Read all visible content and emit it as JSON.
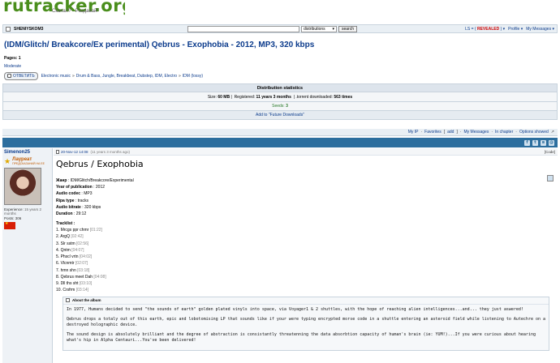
{
  "site": {
    "logo_text": "rutracker.org",
    "tagline": "Скачал? - Раздавай!"
  },
  "topbar": {
    "username": "SHENIYSKOM3",
    "search_value": "",
    "search_scope": "distributions",
    "search_button": "search",
    "user_links": {
      "ls": "LS",
      "revealed": "REVEALED",
      "profile": "Profile",
      "messages": "My Messages"
    }
  },
  "topic": {
    "title": "(IDM/Glitch/ Breakcore/Ex perimental) Qebrus - Exophobia - 2012, MP3, 320 kbps",
    "pages": "Pages: 1",
    "moderate": "Moderate"
  },
  "breadcrumb": {
    "reply_label": "ОТВЕТИТЬ",
    "items": [
      "Electronic music",
      "Drum & Bass, Jungle, Breakbeat, Dubstep, IDM, Electro",
      "IDM (lossy)"
    ]
  },
  "stats": {
    "header": "Distribution statistics",
    "size_label": "Size:",
    "size": "60 MB",
    "registered_label": "Registered:",
    "registered": "11 years 3 months",
    "downloaded_label": ".torrent downloaded:",
    "downloaded": "563 times",
    "seeds_label": "Seeds:",
    "seeds": "3",
    "future_downloads": "Add to \"Future Downloads\""
  },
  "links_bar": {
    "my_ip": "My IP",
    "favorites": "Favorites",
    "add": "add",
    "my_messages": "My Messages",
    "in_chapter": "In chapter",
    "options": "Options showed"
  },
  "author": {
    "name": "Simenon25",
    "rank": "Лауреат",
    "rank_sub": "ПРЕДСКАЗАНИЙ НА ЕЕ",
    "experience_label": "Experience:",
    "experience": "15 years 2 months",
    "posts_label": "Posts:",
    "posts": "306"
  },
  "post": {
    "date": "20-Nov-12 14:08",
    "ago": "(11 years 3 months ago)",
    "code": "[Code]",
    "heading": "Qebrus / Exophobia",
    "genre_label": "Жанр",
    "genre": "IDM/Glitch/Breakcore/Experimental",
    "year_label": "Year of publication",
    "year": "2012",
    "codec_label": "Audio codec",
    "codec": "MP3",
    "rip_label": "Ripa type",
    "rip": "tracks",
    "bitrate_label": "Audio bitrate",
    "bitrate": "320 kbps",
    "duration_label": "Duration",
    "duration": "29:12",
    "tracklist_label": "Tracklist",
    "tracks": [
      {
        "n": "1.",
        "title": "Mrcgs ppr chmr",
        "d": "[01:22]"
      },
      {
        "n": "2.",
        "title": "ArgQ",
        "d": "[02:42]"
      },
      {
        "n": "3.",
        "title": "Slr sstm",
        "d": "[02:56]"
      },
      {
        "n": "4.",
        "title": "Qntm",
        "d": "[04:07]"
      },
      {
        "n": "5.",
        "title": "Phscl vrtn",
        "d": "[04:02]"
      },
      {
        "n": "6.",
        "title": "Vlcnmtr",
        "d": "[02:07]"
      },
      {
        "n": "7.",
        "title": "hmn shn",
        "d": "[03:18]"
      },
      {
        "n": "8.",
        "title": "Qebrus meet Dah",
        "d": "[04:08]"
      },
      {
        "n": "9.",
        "title": "Dll ths sht",
        "d": "[03:10]"
      },
      {
        "n": "10.",
        "title": "Crsfrm",
        "d": "[03:14]"
      }
    ],
    "album_header": "About the album",
    "album_paragraphs": [
      "In 1977, Humans decided to send \"the sounds of earth\" golden plated vinyls into space, via Voyager1 & 2 shuttles, with the hope of reaching alien intelligences...and... they just aswered!",
      "Qebrus drops a totaly out of this earth, epic and lobotomising LP that sounds like if your were typing encrypted morse code in a shuttle entering an asteroid field while listening to Autechre on a destroyed holographic device.",
      "The sound design is absolutely brilliant and the degree of abstraction is consistantly threatenning the data absorbtion capacity of human's brain (ie: YUM!)...If you were curious about hearing what's hip in Alpha Centauri...You've been delivered!"
    ]
  }
}
